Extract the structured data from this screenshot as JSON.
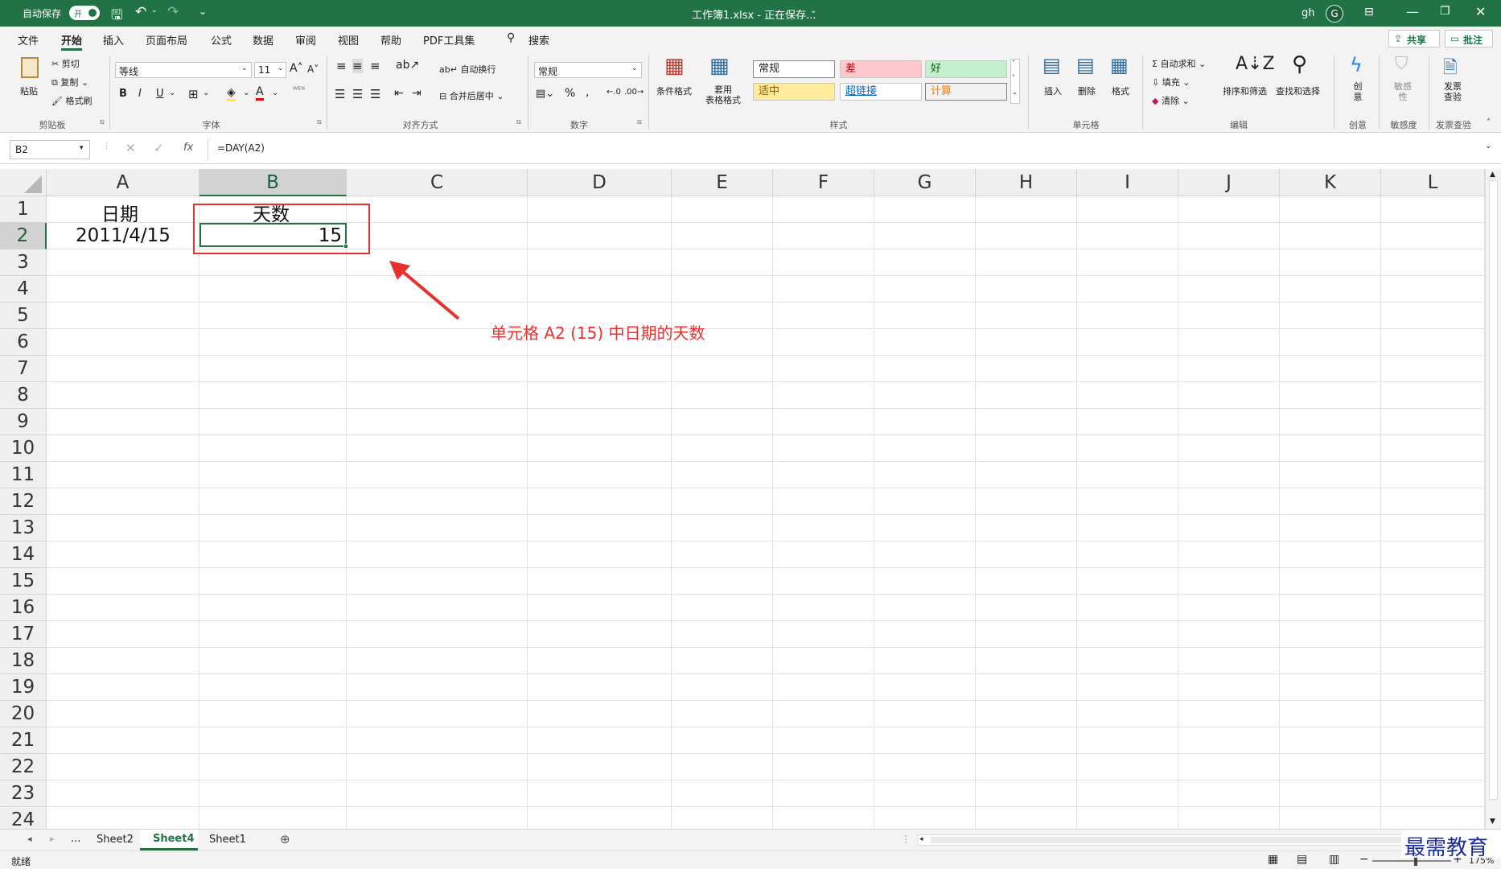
{
  "titlebar": {
    "autosave_label": "自动保存",
    "autosave_state": "开",
    "title": "工作簿1.xlsx - 正在保存...",
    "user_initials": "gh",
    "avatar_letter": "G"
  },
  "tabs": [
    "文件",
    "开始",
    "插入",
    "页面布局",
    "公式",
    "数据",
    "审阅",
    "视图",
    "帮助",
    "PDF工具集"
  ],
  "active_tab": "开始",
  "search_label": "搜索",
  "share_label": "共享",
  "comment_label": "批注",
  "ribbon": {
    "clipboard": {
      "paste": "粘贴",
      "cut": "剪切",
      "copy": "复制",
      "format_painter": "格式刷",
      "group": "剪贴板"
    },
    "font": {
      "name": "等线",
      "size": "11",
      "bold": "B",
      "italic": "I",
      "underline": "U",
      "group": "字体"
    },
    "alignment": {
      "wrap": "自动换行",
      "merge": "合并后居中",
      "group": "对齐方式"
    },
    "number": {
      "format": "常规",
      "group": "数字"
    },
    "styles": {
      "conditional": "条件格式",
      "table": "套用\n表格格式",
      "cells": [
        {
          "label": "常规",
          "bg": "#ffffff",
          "fg": "#000000"
        },
        {
          "label": "差",
          "bg": "#ffc7ce",
          "fg": "#9c0006"
        },
        {
          "label": "好",
          "bg": "#c6efce",
          "fg": "#006100"
        },
        {
          "label": "适中",
          "bg": "#ffeb9c",
          "fg": "#9c5700"
        },
        {
          "label": "超链接",
          "bg": "#ffffff",
          "fg": "#0563c1"
        },
        {
          "label": "计算",
          "bg": "#f2f2f2",
          "fg": "#fa7d00"
        }
      ],
      "group": "样式"
    },
    "cells_group": {
      "insert": "插入",
      "delete": "删除",
      "format": "格式",
      "group": "单元格"
    },
    "editing": {
      "autosum": "自动求和",
      "fill": "填充",
      "clear": "清除",
      "sort": "排序和筛选",
      "find": "查找和选择",
      "group": "编辑"
    },
    "ideas": {
      "label": "创\n意",
      "group": "创意"
    },
    "sensitivity": {
      "label": "敏感\n性",
      "group": "敏感度"
    },
    "invoice": {
      "label": "发票\n查验",
      "group": "发票查验"
    }
  },
  "formula_bar": {
    "name_box": "B2",
    "fx": "fx",
    "formula": "=DAY(A2)"
  },
  "sheet": {
    "columns": [
      "A",
      "B",
      "C",
      "D",
      "E",
      "F",
      "G",
      "H",
      "I",
      "J",
      "K",
      "L"
    ],
    "rows": [
      "1",
      "2",
      "3",
      "4",
      "5",
      "6",
      "7",
      "8",
      "9",
      "10",
      "11",
      "12",
      "13",
      "14",
      "15",
      "16",
      "17",
      "18",
      "19",
      "20",
      "21",
      "22",
      "23",
      "24"
    ],
    "cells": {
      "A1": "日期",
      "B1": "天数",
      "A2": "2011/4/15",
      "B2": "15"
    },
    "selected_cell": "B2"
  },
  "annotation": {
    "text": "单元格 A2 (15) 中日期的天数",
    "color": "#e8312f"
  },
  "sheet_tabs": {
    "ellipsis": "...",
    "tabs": [
      "Sheet2",
      "Sheet4",
      "Sheet1"
    ],
    "active": "Sheet4"
  },
  "status": {
    "ready": "就绪",
    "zoom": "175%"
  },
  "watermark": "最需教育"
}
